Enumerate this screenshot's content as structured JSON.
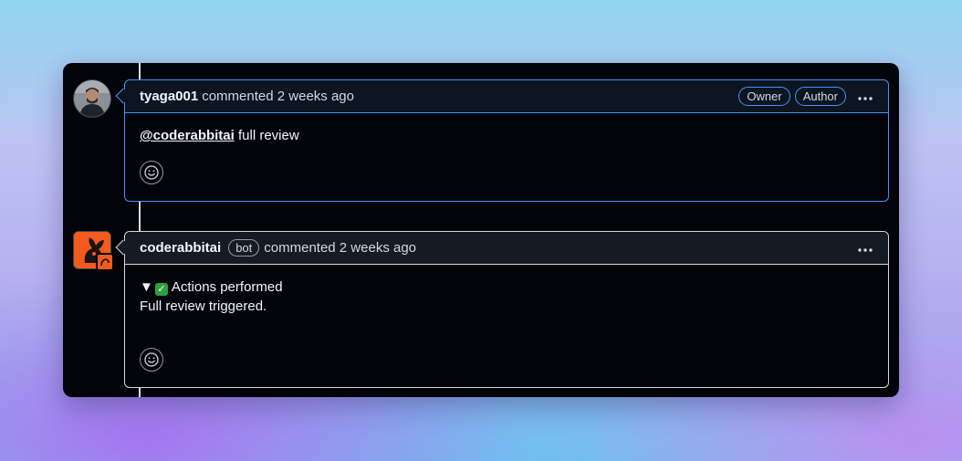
{
  "comments": [
    {
      "author": "tyaga001",
      "action": "commented 2 weeks ago",
      "badges": [
        "Owner",
        "Author"
      ],
      "more_icon": "kebab-horizontal-icon",
      "body": {
        "mention": "@coderabbitai",
        "text": "full review"
      },
      "reaction_icon": "smiley-icon"
    },
    {
      "author": "coderabbitai",
      "bot_badge": "bot",
      "action": "commented 2 weeks ago",
      "more_icon": "kebab-horizontal-icon",
      "body": {
        "summary_marker": "▼",
        "summary_icon": "check-mark-icon",
        "summary": "Actions performed",
        "text": "Full review triggered."
      },
      "reaction_icon": "smiley-icon"
    }
  ],
  "colors": {
    "accent": "#4493f8",
    "bot_brand": "#f35b1e",
    "success": "#2ea043"
  }
}
